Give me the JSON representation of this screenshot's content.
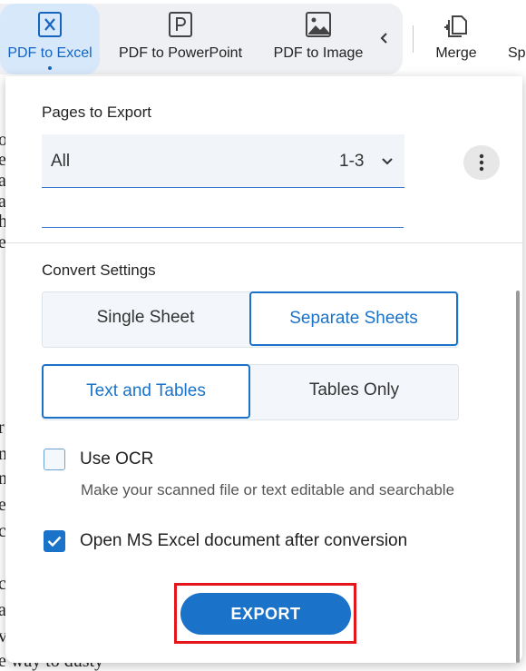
{
  "toolbar": {
    "tools": [
      {
        "label": "PDF to Excel",
        "icon": "excel-x-icon",
        "active": true
      },
      {
        "label": "PDF to PowerPoint",
        "icon": "powerpoint-p-icon",
        "active": false
      },
      {
        "label": "PDF to Image",
        "icon": "image-icon",
        "active": false
      },
      {
        "label": "Merge",
        "icon": "merge-icon",
        "active": false
      },
      {
        "label": "Sp",
        "icon": "split-icon",
        "active": false
      }
    ],
    "scroll_left_icon": "chevron-left-icon"
  },
  "background_document": {
    "fragments_top": [
      "o",
      "e",
      "ar",
      "a",
      "h",
      "e"
    ],
    "fragments_bottom": [
      "r",
      "n",
      "n",
      "e",
      "c",
      "c",
      "a",
      "v"
    ],
    "last_line": "e way to dusty"
  },
  "panel": {
    "pages_label": "Pages to Export",
    "pages_value": "All",
    "pages_range": "1-3",
    "more_icon": "more-vertical-icon",
    "convert_label": "Convert Settings",
    "sheet_options": [
      "Single Sheet",
      "Separate Sheets"
    ],
    "sheet_selected": "Separate Sheets",
    "content_options": [
      "Text and Tables",
      "Tables Only"
    ],
    "content_selected": "Text and Tables",
    "ocr": {
      "label": "Use OCR",
      "checked": false,
      "hint": "Make your scanned file or text editable and searchable"
    },
    "open_after": {
      "label": "Open MS Excel document after conversion",
      "checked": true
    },
    "export_label": "EXPORT"
  },
  "colors": {
    "accent": "#1a73c8",
    "highlight_box": "#e4151b",
    "active_tab_bg": "#d8e8fb"
  }
}
